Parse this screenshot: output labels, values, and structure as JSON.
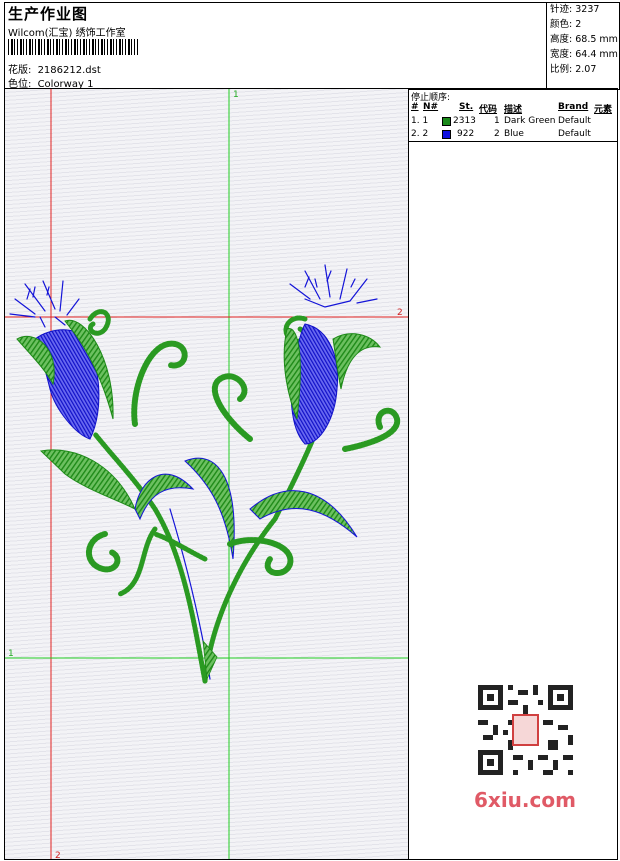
{
  "header": {
    "title": "生产作业图",
    "subtitle": "Wilcom(汇宝) 绣饰工作室",
    "design_label": "花版:",
    "design_value": "2186212.dst",
    "colorway_label": "色位:",
    "colorway_value": "Colorway 1"
  },
  "stats": {
    "stitches_label": "针迹:",
    "stitches_value": "3237",
    "colors_label": "颜色:",
    "colors_value": "2",
    "height_label": "高度:",
    "height_value": "68.5 mm",
    "width_label": "宽度:",
    "width_value": "64.4 mm",
    "scale_label": "比例:",
    "scale_value": "2.07"
  },
  "stop_sequence": {
    "title": "停止顺序:",
    "columns": [
      "#",
      "N#",
      "St.",
      "代码",
      "描述",
      "Brand",
      "元素"
    ],
    "rows": [
      {
        "index": "1. 1",
        "color": "#1a8a1a",
        "stitches": "2313",
        "code": "1",
        "description": "Dark Green",
        "brand": "Default"
      },
      {
        "index": "2. 2",
        "color": "#1010e0",
        "stitches": "922",
        "code": "2",
        "description": "Blue",
        "brand": "Default"
      }
    ]
  },
  "guides": {
    "vertical_green": "1",
    "horizontal_red": "2",
    "horizontal_green": "1",
    "vertical_red": "2"
  },
  "colors": {
    "green_thread": "#2a9a22",
    "blue_thread": "#1414d8",
    "guide_red": "#e02020",
    "guide_green": "#22cc22"
  },
  "watermark": "6xiu.com"
}
